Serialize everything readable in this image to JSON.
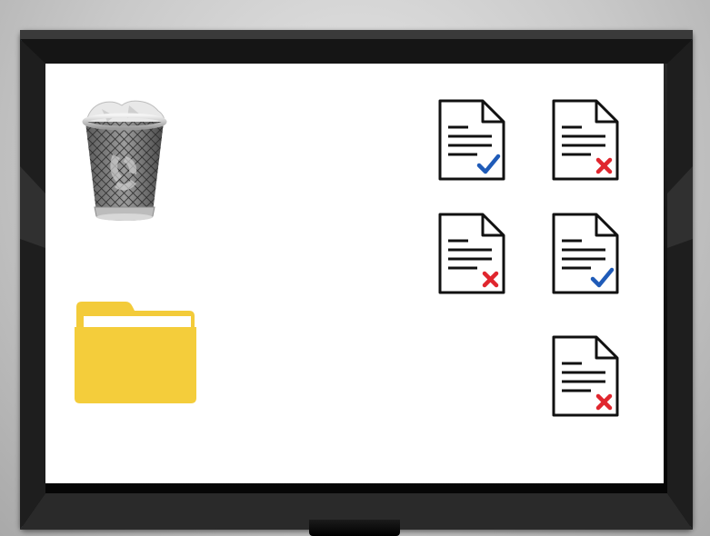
{
  "desktop": {
    "icons": [
      {
        "name": "trash-can-icon",
        "kind": "trash"
      },
      {
        "name": "folder-icon",
        "kind": "folder",
        "color": "#F3CB3A"
      }
    ],
    "documents": [
      {
        "id": "doc-1",
        "status": "approved",
        "mark_color": "#1F5BB8"
      },
      {
        "id": "doc-2",
        "status": "rejected",
        "mark_color": "#E0262E"
      },
      {
        "id": "doc-3",
        "status": "rejected",
        "mark_color": "#E0262E"
      },
      {
        "id": "doc-4",
        "status": "approved",
        "mark_color": "#1F5BB8"
      },
      {
        "id": "doc-5",
        "status": "rejected",
        "mark_color": "#E0262E"
      }
    ]
  },
  "colors": {
    "bezel": "#0c0c0c",
    "bezel_edge": "#6f8fa8",
    "screen": "#ffffff",
    "background": "#c9c9c9"
  }
}
